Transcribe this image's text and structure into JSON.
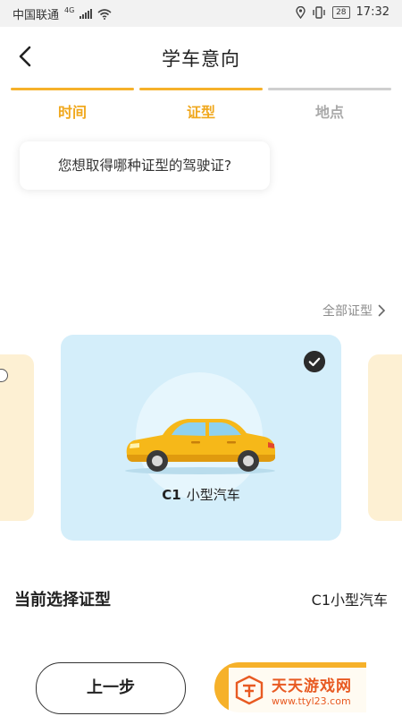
{
  "status_bar": {
    "carrier": "中国联通",
    "net": "4G",
    "battery": "28",
    "time": "17:32"
  },
  "header": {
    "title": "学车意向"
  },
  "steps": [
    {
      "label": "时间",
      "active": true
    },
    {
      "label": "证型",
      "active": true
    },
    {
      "label": "地点",
      "active": false
    }
  ],
  "question": "您想取得哪种证型的驾驶证?",
  "all_types_link": "全部证型",
  "card": {
    "code": "C1",
    "name": "小型汽车",
    "selected": true
  },
  "current_selection": {
    "label": "当前选择证型",
    "value": "C1小型汽车"
  },
  "buttons": {
    "prev": "上一步"
  },
  "watermark": {
    "title": "天天游戏网",
    "url": "www.ttyl23.com"
  },
  "colors": {
    "accent": "#f6b12a",
    "card_bg": "#d4eefa",
    "side_card_bg": "#fdf0d3",
    "watermark": "#e85a22"
  }
}
